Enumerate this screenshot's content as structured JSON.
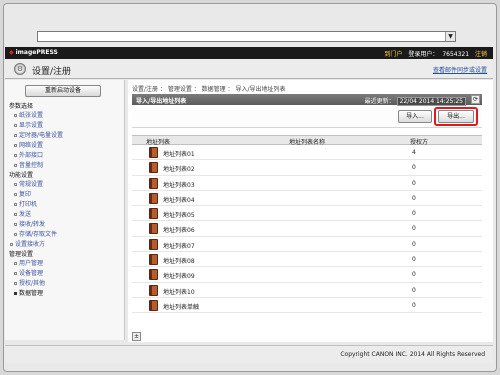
{
  "browser": {
    "address_value": "",
    "dropdown_glyph": "▼"
  },
  "topbar": {
    "brand": "imagePRESS",
    "portal_link": "到门户",
    "login_label": "登录用户：",
    "user_id": "7654321",
    "logout_link": "注销"
  },
  "titlebar": {
    "title": "设置/注册",
    "link": "查看邮件同步或设置"
  },
  "sidebar": {
    "restart_button": "重新启动设备",
    "sections": [
      {
        "heading": "参数选择",
        "items": [
          "纸张设置",
          "显示设置",
          "定时器/电量设置",
          "网络设置",
          "外部接口",
          "音量控制"
        ]
      },
      {
        "heading": "功能设置",
        "items": [
          "常规设置",
          "复印",
          "打印机",
          "发送",
          "接收/转发",
          "存储/存取文件"
        ]
      }
    ],
    "standalone_item": "设置接收方",
    "management": {
      "heading": "管理设置",
      "items": [
        "用户管理",
        "设备管理",
        "授权/其他",
        "数据管理"
      ],
      "active": "数据管理"
    }
  },
  "main": {
    "breadcrumb": "设置/注册 ： 管理设置 ： 数据管理 ： 导入/导出地址列表",
    "panel_title": "导入/导出地址列表",
    "last_update_label": "最近更新：",
    "last_update_value": "22/04 2014 14:25:25",
    "refresh_glyph": "⟳",
    "import_button": "导入...",
    "export_button": "导出...",
    "columns": [
      "地址列表",
      "地址列表名称",
      "授权方"
    ],
    "rows": [
      {
        "name": "地址列表01",
        "auth": "4"
      },
      {
        "name": "地址列表02",
        "auth": "0"
      },
      {
        "name": "地址列表03",
        "auth": "0"
      },
      {
        "name": "地址列表04",
        "auth": "0"
      },
      {
        "name": "地址列表05",
        "auth": "0"
      },
      {
        "name": "地址列表06",
        "auth": "0"
      },
      {
        "name": "地址列表07",
        "auth": "0"
      },
      {
        "name": "地址列表08",
        "auth": "0"
      },
      {
        "name": "地址列表09",
        "auth": "0"
      },
      {
        "name": "地址列表10",
        "auth": "0"
      },
      {
        "name": "地址列表单触",
        "auth": "0"
      }
    ],
    "page_glyph": "±"
  },
  "footer": {
    "copyright": "Copyright CANON INC. 2014 All Rights Reserved"
  },
  "colors": {
    "highlight": "#e0191a",
    "link": "#234f9c",
    "topbar": "#1a1a1a"
  }
}
